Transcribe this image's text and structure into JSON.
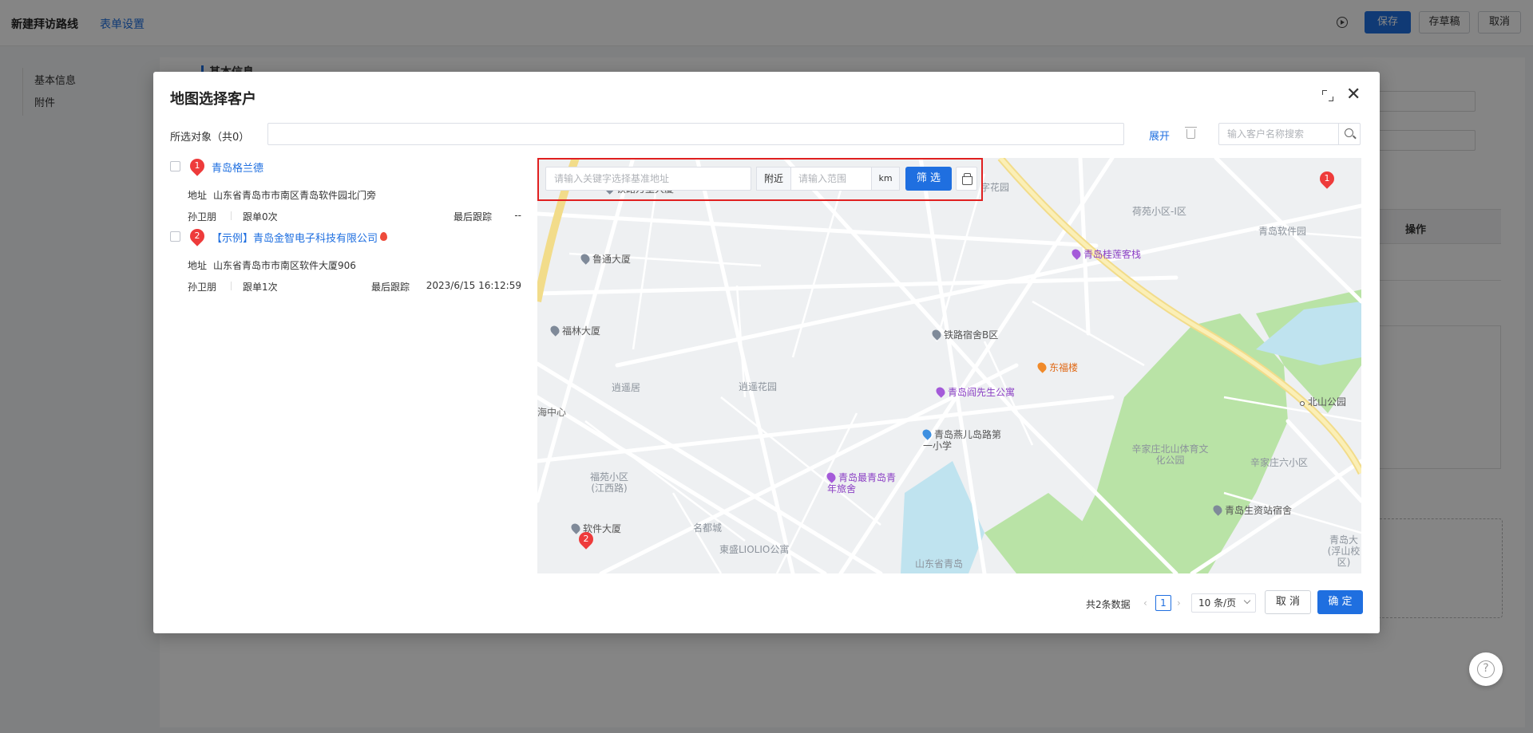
{
  "page": {
    "title": "新建拜访路线",
    "form_settings_link": "表单设置",
    "save_label": "保存",
    "draft_label": "存草稿",
    "cancel_label": "取消",
    "nav": [
      "基本信息",
      "附件"
    ],
    "section_title": "基本信息",
    "table_op_header": "操作"
  },
  "modal": {
    "title": "地图选择客户",
    "selected_label": "所选对象（共0）",
    "expand_label": "展开",
    "search_placeholder": "输入客户名称搜索",
    "customers": [
      {
        "index": "1",
        "name": "青岛格兰德",
        "address_label": "地址",
        "address": "山东省青岛市市南区青岛软件园北门旁",
        "owner": "孙卫朋",
        "follow_count": "跟单0次",
        "last_follow_label": "最后跟踪",
        "last_follow_value": "--"
      },
      {
        "index": "2",
        "name": "【示例】青岛金智电子科技有限公司",
        "address_label": "地址",
        "address": "山东省青岛市市南区软件大厦906",
        "owner": "孙卫朋",
        "follow_count": "跟单1次",
        "last_follow_label": "最后跟踪",
        "last_follow_value": "2023/6/15 16:12:59"
      }
    ],
    "filter": {
      "keyword_placeholder": "请输入关键字选择基准地址",
      "near_label": "附近",
      "range_placeholder": "请输入范围",
      "unit": "km",
      "filter_button": "筛 选"
    },
    "map": {
      "pois": [
        {
          "label": "铁路万里大厦",
          "kind": "gray"
        },
        {
          "label": "鲁通大厦",
          "kind": "gray"
        },
        {
          "label": "青岛桂莲客栈",
          "kind": "purple"
        },
        {
          "label": "福林大厦",
          "kind": "gray"
        },
        {
          "label": "铁路宿舍B区",
          "kind": "gray"
        },
        {
          "label": "东福楼",
          "kind": "orange"
        },
        {
          "label": "青岛阎先生公寓",
          "kind": "purple"
        },
        {
          "label": "北山公园",
          "kind": "gray"
        },
        {
          "label": "青岛燕儿岛路第一小学",
          "kind": "blue"
        },
        {
          "label": "青岛最青岛青年旅舍",
          "kind": "purple"
        },
        {
          "label": "软件大厦",
          "kind": "gray"
        },
        {
          "label": "青岛生资站宿舍",
          "kind": "gray"
        }
      ],
      "areas": [
        "字花园",
        "荷苑小区-I区",
        "青岛软件园",
        "逍遥居",
        "逍遥花园",
        "海中心",
        "辛家庄北山体育文化公园",
        "辛家庄六小区",
        "福苑小区(江西路)",
        "名都城",
        "東盛LIOLIO公寓",
        "山东省青岛",
        "青岛大(浮山校区)"
      ]
    },
    "pagination": {
      "total": "共2条数据",
      "current_page": "1",
      "page_size": "10 条/页"
    },
    "cancel_label": "取 消",
    "ok_label": "确 定"
  }
}
